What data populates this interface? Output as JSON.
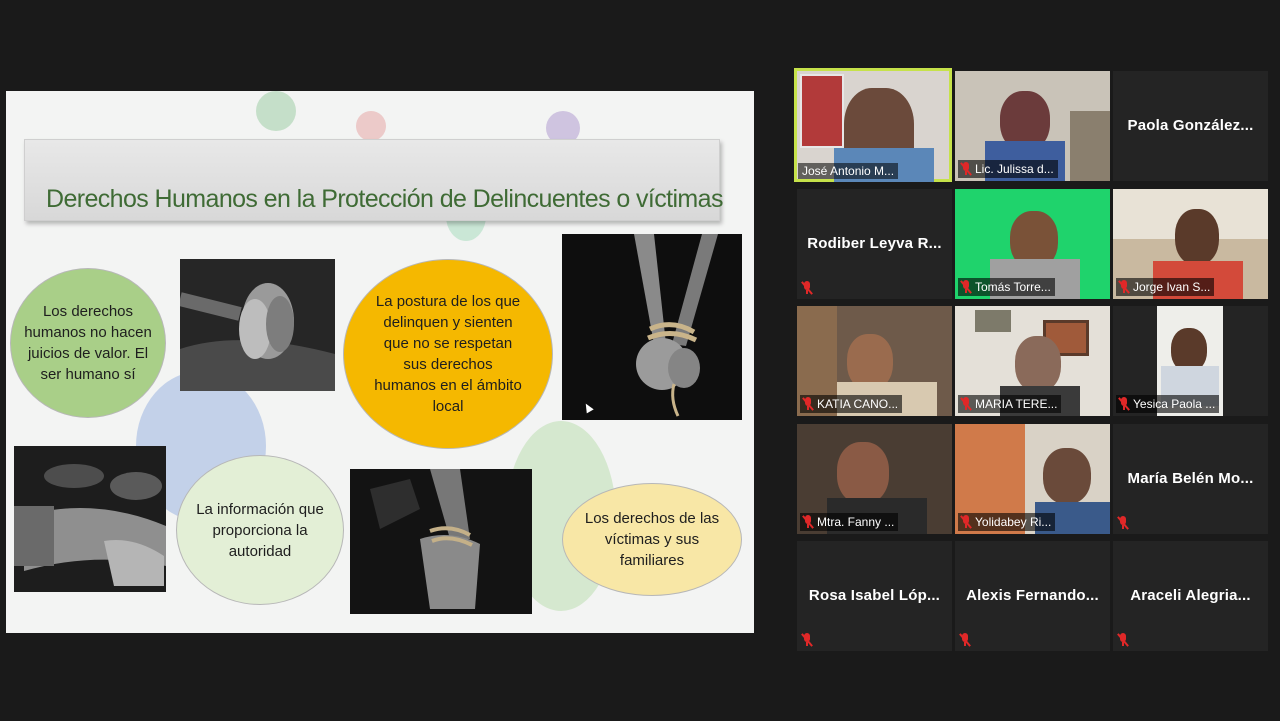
{
  "slide": {
    "title": "Derechos Humanos en la Protección de Delincuentes o víctimas",
    "bubbles": {
      "b1": "Los derechos humanos no hacen juicios de valor. El ser humano sí",
      "b2": "La postura de los que delinquen y sienten que no se respetan sus derechos humanos en el ámbito local",
      "b3": "La información que proporciona la autoridad",
      "b4": "Los derechos de las víctimas y sus familiares"
    }
  },
  "participants": [
    {
      "name": "José Antonio M...",
      "video": true,
      "muted": false
    },
    {
      "name": "Lic. Julissa d...",
      "video": true,
      "muted": true
    },
    {
      "name": "Paola  González...",
      "video": false,
      "muted": false
    },
    {
      "name": "Rodiber  Leyva  R...",
      "video": false,
      "muted": true
    },
    {
      "name": "Tomás Torre...",
      "video": true,
      "muted": true
    },
    {
      "name": "Jorge Ivan S...",
      "video": true,
      "muted": true
    },
    {
      "name": "KATIA CANO...",
      "video": true,
      "muted": true
    },
    {
      "name": "MARIA TERE...",
      "video": true,
      "muted": true
    },
    {
      "name": "Yesica Paola ...",
      "video": true,
      "muted": true
    },
    {
      "name": "Mtra. Fanny ...",
      "video": true,
      "muted": true
    },
    {
      "name": "Yolidabey Ri...",
      "video": true,
      "muted": true
    },
    {
      "name": "María  Belén  Mo...",
      "video": false,
      "muted": true
    },
    {
      "name": "Rosa  Isabel  Lóp...",
      "video": false,
      "muted": true
    },
    {
      "name": "Alexis  Fernando...",
      "video": false,
      "muted": true
    },
    {
      "name": "Araceli  Alegria...",
      "video": false,
      "muted": true
    }
  ],
  "colors": {
    "active_speaker_border": "#c6e24a",
    "muted_icon": "#e02828",
    "title_green": "#3f6b35",
    "bubble_green": "#a9cf88",
    "bubble_orange": "#f5b800",
    "bubble_light_green": "#e3efd6",
    "bubble_yellow": "#f8e7a6"
  },
  "icons": [
    "microphone-muted-icon",
    "mouse-cursor-icon"
  ]
}
